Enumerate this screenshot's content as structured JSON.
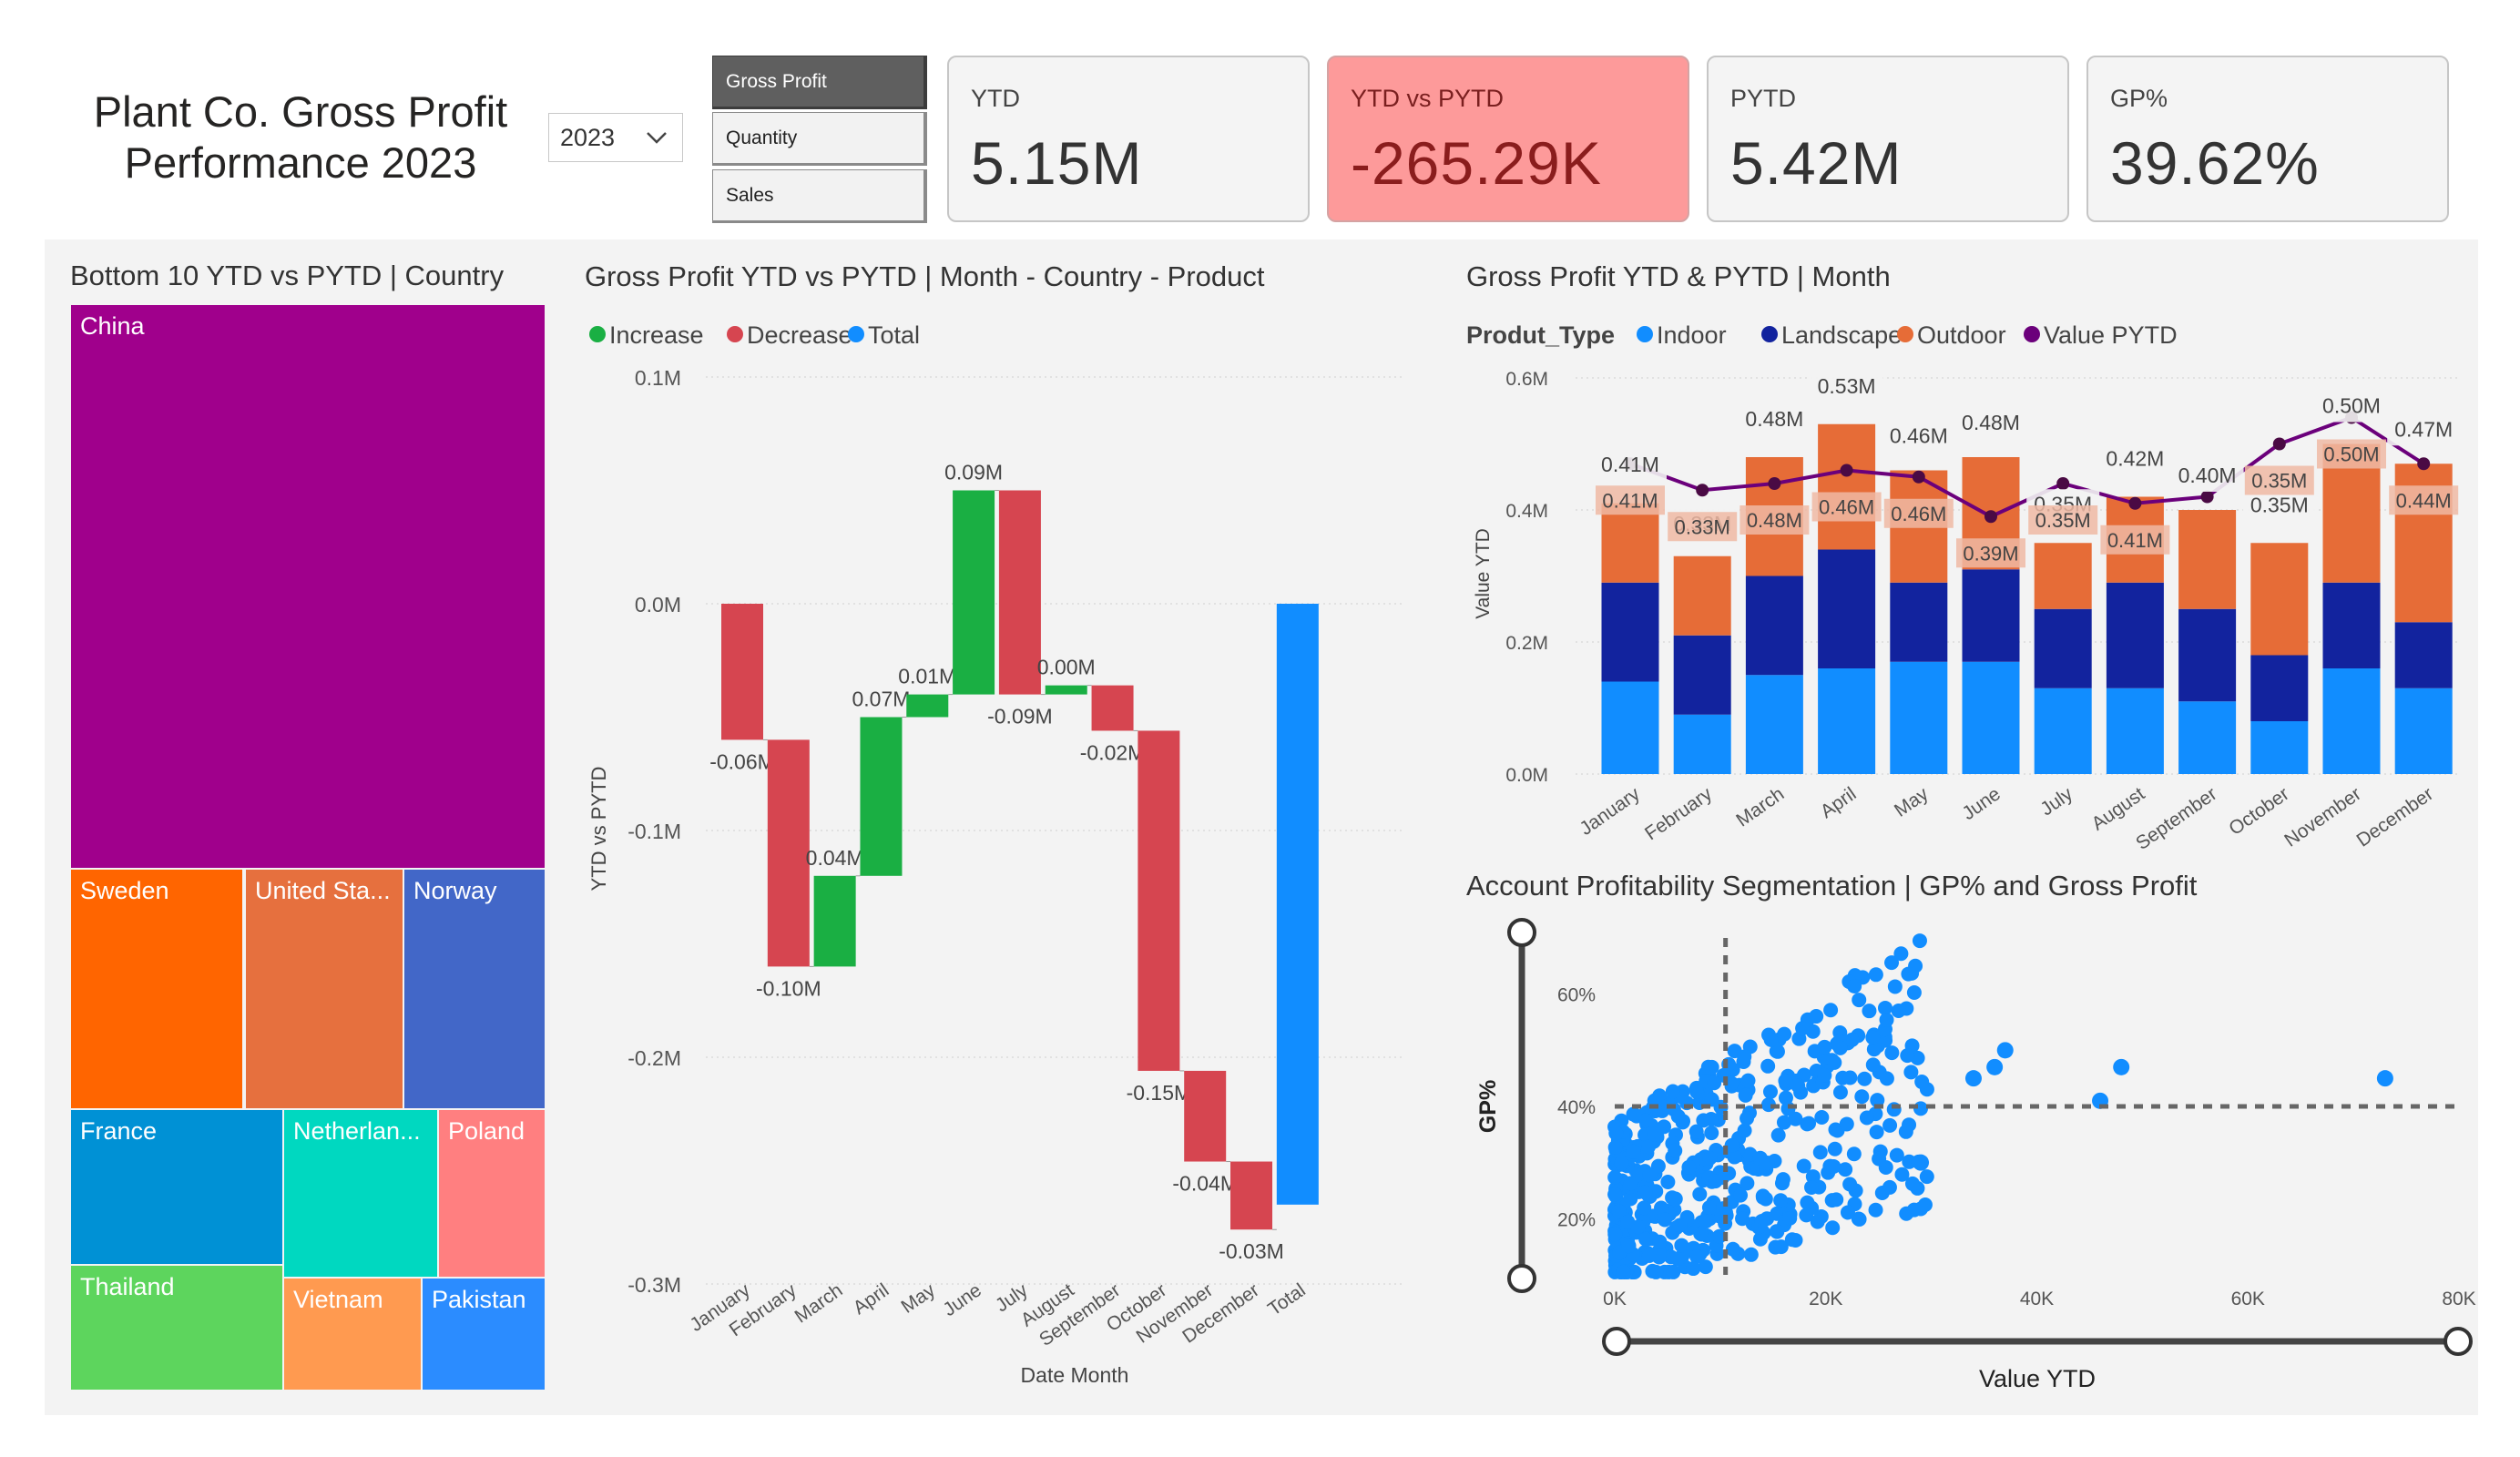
{
  "header": {
    "title_line1": "Plant Co. Gross Profit",
    "title_line2": "Performance 2023",
    "year_selected": "2023",
    "metric_buttons": [
      {
        "label": "Gross Profit",
        "active": true
      },
      {
        "label": "Quantity",
        "active": false
      },
      {
        "label": "Sales",
        "active": false
      }
    ]
  },
  "kpis": [
    {
      "label": "YTD",
      "value": "5.15M",
      "negative": false
    },
    {
      "label": "YTD vs PYTD",
      "value": "-265.29K",
      "negative": true
    },
    {
      "label": "PYTD",
      "value": "5.42M",
      "negative": false
    },
    {
      "label": "GP%",
      "value": "39.62%",
      "negative": false
    }
  ],
  "colors": {
    "increase": "#1aaf43",
    "decrease": "#d64550",
    "total": "#118dff",
    "indoor": "#118dff",
    "landscape": "#12239e",
    "outdoor": "#e66c37",
    "pytd_line": "#6b007b",
    "scatter": "#118dff",
    "kpi_negative_bg": "#fd9a9a"
  },
  "chart_data": [
    {
      "type": "treemap",
      "title": "Bottom 10 YTD vs PYTD | Country",
      "items": [
        {
          "label": "China",
          "color": "#a0008c"
        },
        {
          "label": "Sweden",
          "color": "#ff6500"
        },
        {
          "label": "United Sta...",
          "color": "#e6703e"
        },
        {
          "label": "Norway",
          "color": "#4267c8"
        },
        {
          "label": "France",
          "color": "#0091d5"
        },
        {
          "label": "Netherlan...",
          "color": "#00d8c0"
        },
        {
          "label": "Poland",
          "color": "#ff7f80"
        },
        {
          "label": "Thailand",
          "color": "#5dd55d"
        },
        {
          "label": "Vietnam",
          "color": "#ff9a50"
        },
        {
          "label": "Pakistan",
          "color": "#2b8cff"
        }
      ]
    },
    {
      "type": "waterfall",
      "title": "Gross Profit YTD vs PYTD | Month - Country - Product",
      "legend": [
        "Increase",
        "Decrease",
        "Total"
      ],
      "xlabel": "Date Month",
      "ylabel": "YTD vs PYTD",
      "categories": [
        "January",
        "February",
        "March",
        "April",
        "May",
        "June",
        "July",
        "August",
        "September",
        "October",
        "November",
        "December",
        "Total"
      ],
      "values": [
        -0.06,
        -0.1,
        0.04,
        0.07,
        0.01,
        0.09,
        -0.09,
        0.004,
        -0.02,
        -0.15,
        -0.04,
        -0.03,
        -0.265
      ],
      "data_labels": [
        "-0.06M",
        "-0.10M",
        "0.04M",
        "0.07M",
        "0.01M",
        "0.09M",
        "-0.09M",
        "0.00M",
        "-0.02M",
        "-0.15M",
        "-0.04M",
        "-0.03M",
        ""
      ],
      "ylim": [
        -0.3,
        0.1
      ],
      "yticks": [
        0.1,
        0.0,
        -0.1,
        -0.2,
        -0.3
      ],
      "ytick_labels": [
        "0.1M",
        "0.0M",
        "-0.1M",
        "-0.2M",
        "-0.3M"
      ]
    },
    {
      "type": "bar",
      "stacked": true,
      "title": "Gross Profit YTD & PYTD | Month",
      "legend_title": "Produt_Type",
      "legend": [
        "Indoor",
        "Landscape",
        "Outdoor",
        "Value PYTD"
      ],
      "ylabel": "Value YTD",
      "categories": [
        "January",
        "February",
        "March",
        "April",
        "May",
        "June",
        "July",
        "August",
        "September",
        "October",
        "November",
        "December"
      ],
      "series": [
        {
          "name": "Indoor",
          "values": [
            0.14,
            0.09,
            0.15,
            0.16,
            0.17,
            0.17,
            0.13,
            0.13,
            0.11,
            0.08,
            0.16,
            0.13
          ]
        },
        {
          "name": "Landscape",
          "values": [
            0.15,
            0.12,
            0.15,
            0.18,
            0.12,
            0.14,
            0.12,
            0.16,
            0.14,
            0.1,
            0.13,
            0.1
          ]
        },
        {
          "name": "Outdoor",
          "values": [
            0.12,
            0.12,
            0.18,
            0.19,
            0.17,
            0.17,
            0.1,
            0.13,
            0.15,
            0.17,
            0.21,
            0.24
          ]
        }
      ],
      "totals_labels": [
        "0.41M",
        "0.33M",
        "0.48M",
        "0.53M",
        "0.46M",
        "0.48M",
        "0.35M",
        "0.42M",
        "0.40M",
        "0.35M",
        "0.50M",
        "0.47M"
      ],
      "line": {
        "name": "Value PYTD",
        "values": [
          0.47,
          0.43,
          0.44,
          0.46,
          0.45,
          0.39,
          0.44,
          0.41,
          0.42,
          0.5,
          0.54,
          0.47
        ]
      },
      "line_labels": [
        "0.41M",
        "0.33M",
        "0.48M",
        "0.46M",
        "0.46M",
        "0.39M",
        "0.35M",
        "0.41M",
        "",
        "0.35M",
        "0.50M",
        "0.44M"
      ],
      "ylim": [
        0,
        0.6
      ],
      "yticks": [
        0,
        0.2,
        0.4,
        0.6
      ],
      "ytick_labels": [
        "0.0M",
        "0.2M",
        "0.4M",
        "0.6M"
      ]
    },
    {
      "type": "scatter",
      "title": "Account Profitability Segmentation | GP% and Gross Profit",
      "xlabel": "Value YTD",
      "ylabel": "GP%",
      "xlim": [
        0,
        80000
      ],
      "ylim": [
        10,
        70
      ],
      "xticks": [
        0,
        20000,
        40000,
        60000,
        80000
      ],
      "xtick_labels": [
        "0K",
        "20K",
        "40K",
        "60K",
        "80K"
      ],
      "yticks": [
        20,
        40,
        60
      ],
      "ytick_labels": [
        "20%",
        "40%",
        "60%"
      ],
      "reference_lines": {
        "x": 10500,
        "y": 40
      },
      "outliers": [
        {
          "x": 73000,
          "y": 45
        },
        {
          "x": 48000,
          "y": 47
        },
        {
          "x": 46000,
          "y": 41
        },
        {
          "x": 37000,
          "y": 50
        },
        {
          "x": 36000,
          "y": 47
        },
        {
          "x": 29000,
          "y": 30
        },
        {
          "x": 34000,
          "y": 45
        }
      ],
      "cluster_points": 480
    }
  ]
}
